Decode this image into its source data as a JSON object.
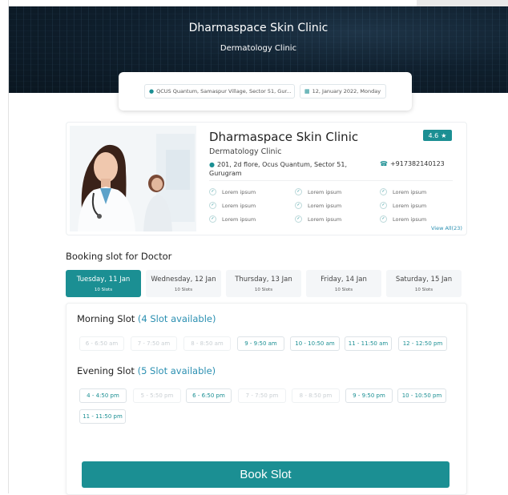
{
  "header": {
    "title": "Dharmaspace Skin Clinic",
    "subtitle": "Dermatology Clinic"
  },
  "search": {
    "location": "QCUS Quantum, Samaspur Village, Sector 51, Gur...",
    "date": "12, January 2022, Monday"
  },
  "clinic": {
    "name": "Dharmaspace Skin Clinic",
    "type": "Dermatology Clinic",
    "address": "201, 2d flore, Ocus Quantum, Sector 51, Gurugram",
    "phone": "+917382140123",
    "rating": "4.6",
    "features": [
      "Lorem ipsum",
      "Lorem ipsum",
      "Lorem ipsum",
      "Lorem ipsum",
      "Lorem ipsum",
      "Lorem ipsum",
      "Lorem ipsum",
      "Lorem ipsum",
      "Lorem ipsum"
    ],
    "view_all": "View All(23)"
  },
  "booking": {
    "heading": "Booking slot for Doctor",
    "days": [
      {
        "label": "Tuesday, 11 Jan",
        "slots": "10 Slots",
        "active": true
      },
      {
        "label": "Wednesday, 12 Jan",
        "slots": "10 Slots",
        "active": false
      },
      {
        "label": "Thursday, 13 Jan",
        "slots": "10 Slots",
        "active": false
      },
      {
        "label": "Friday, 14 Jan",
        "slots": "10 Slots",
        "active": false
      },
      {
        "label": "Saturday, 15 Jan",
        "slots": "10 Slots",
        "active": false
      }
    ],
    "morning": {
      "title": "Morning Slot",
      "available": "(4 Slot available)",
      "slots": [
        {
          "label": "6 - 6:50 am",
          "enabled": false
        },
        {
          "label": "7 - 7:50 am",
          "enabled": false
        },
        {
          "label": "8 - 8:50 am",
          "enabled": false
        },
        {
          "label": "9 - 9:50 am",
          "enabled": true
        },
        {
          "label": "10 - 10:50 am",
          "enabled": true
        },
        {
          "label": "11 - 11:50 am",
          "enabled": true
        },
        {
          "label": "12 - 12:50 pm",
          "enabled": true
        }
      ]
    },
    "evening": {
      "title": "Evening Slot",
      "available": "(5 Slot available)",
      "slots": [
        {
          "label": "4 - 4:50 pm",
          "enabled": true
        },
        {
          "label": "5 - 5:50 pm",
          "enabled": false
        },
        {
          "label": "6 - 6:50 pm",
          "enabled": true
        },
        {
          "label": "7 - 7:50 pm",
          "enabled": false
        },
        {
          "label": "8 - 8:50 pm",
          "enabled": false
        },
        {
          "label": "9 - 9:50 pm",
          "enabled": true
        },
        {
          "label": "10 - 10:50 pm",
          "enabled": true
        },
        {
          "label": "11 - 11:50 pm",
          "enabled": true
        }
      ]
    },
    "book_label": "Book Slot"
  },
  "colors": {
    "accent": "#1b8f93",
    "link": "#2a8fb1",
    "hero_bg": "#0f1f2d"
  }
}
